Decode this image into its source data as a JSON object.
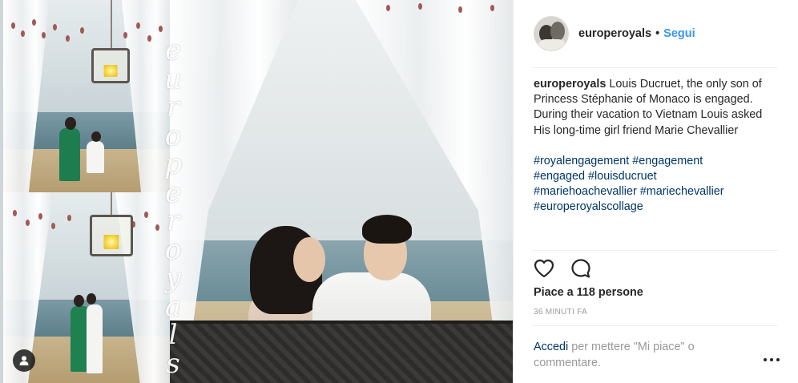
{
  "post": {
    "watermark_letters": [
      "e",
      "u",
      "r",
      "o",
      "p",
      "e",
      "r",
      "o",
      "y",
      "a",
      "l",
      "s"
    ],
    "user_tag_icon": "person-icon"
  },
  "header": {
    "username": "europeroyals",
    "separator": "•",
    "follow_label": "Segui"
  },
  "caption": {
    "username": "europeroyals",
    "text": " Louis Ducruet, the only son of Princess Stéphanie of Monaco is engaged.\nDuring their vacation to Vietnam Louis asked His long-time girl friend Marie Chevallier",
    "hashtags": [
      "#royalengagement #engagement",
      "#engaged #louisducruet",
      "#mariehoachevallier #mariechevallier",
      "#europeroyalscollage"
    ]
  },
  "actions": {
    "like_icon": "heart-icon",
    "comment_icon": "comment-bubble-icon"
  },
  "likes_text": "Piace a 118 persone",
  "timestamp": "36 MINUTI FA",
  "login": {
    "link_text": "Accedi",
    "rest_text": " per mettere \"Mi piace\" o commentare."
  },
  "more_icon": "more-options-icon",
  "colors": {
    "link_blue": "#3897f0",
    "hashtag_blue": "#003569",
    "muted_gray": "#999999",
    "text": "#262626"
  }
}
